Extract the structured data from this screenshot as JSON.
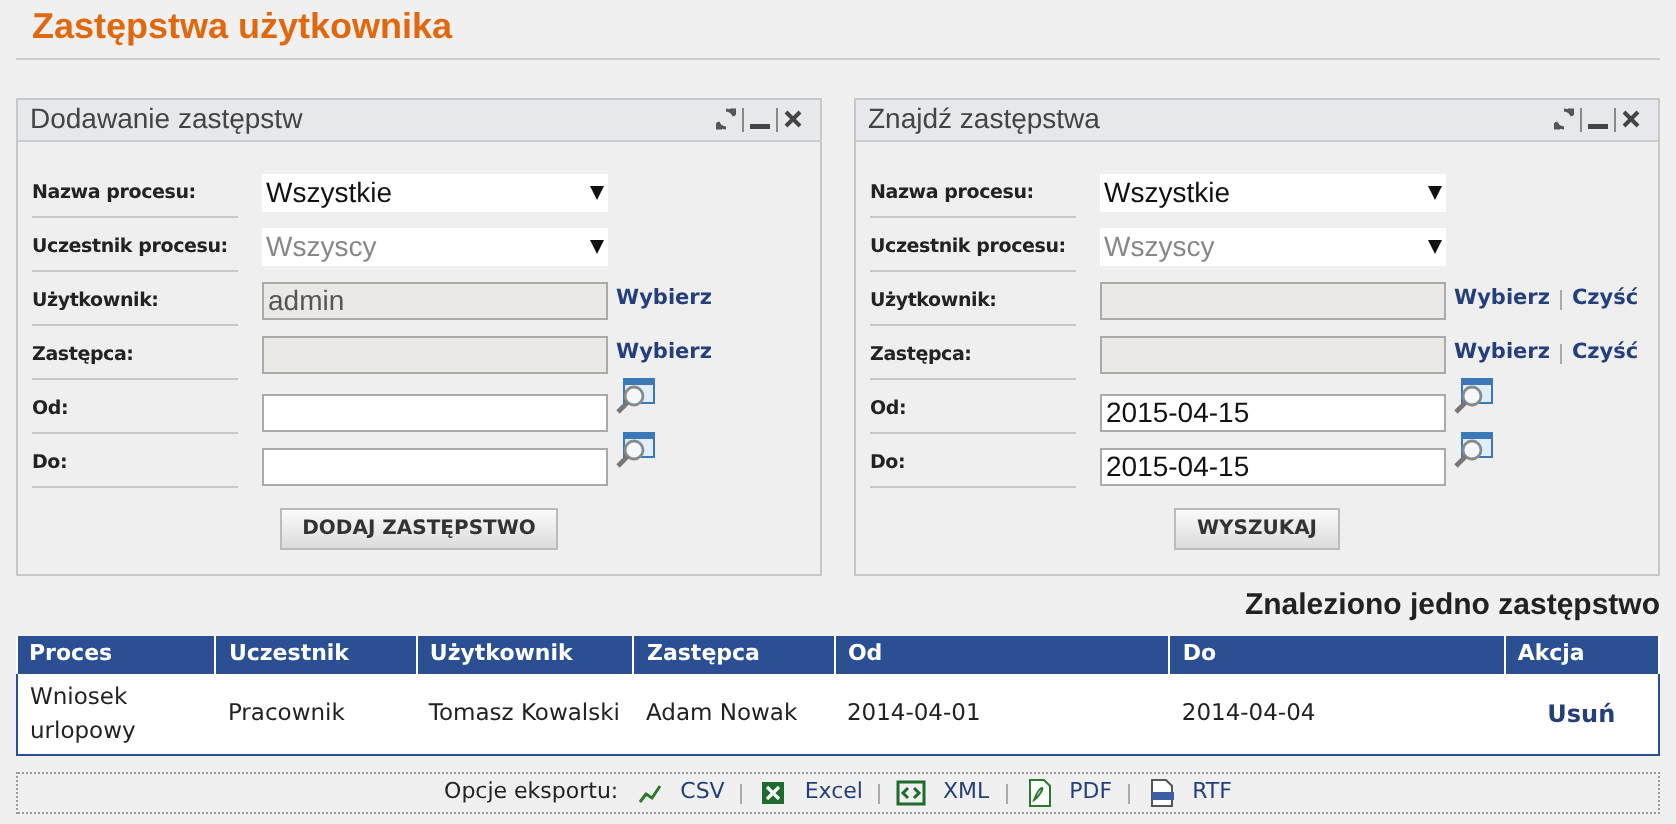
{
  "page_title": "Zastępstwa użytkownika",
  "panels": [
    {
      "title": "Dodawanie zastępstw",
      "fields": [
        {
          "label": "Nazwa procesu:",
          "kind": "select",
          "value": "Wszystkie",
          "disabled": false
        },
        {
          "label": "Uczestnik procesu:",
          "kind": "select",
          "value": "Wszyscy",
          "disabled": true
        },
        {
          "label": "Użytkownik:",
          "kind": "text",
          "value": "admin",
          "disabled": true,
          "links": [
            "Wybierz"
          ]
        },
        {
          "label": "Zastępca:",
          "kind": "text",
          "disabled": true,
          "links": [
            "Wybierz"
          ]
        },
        {
          "label": "Od:",
          "kind": "date",
          "disabled": false
        },
        {
          "label": "Do:",
          "kind": "date",
          "disabled": false
        }
      ],
      "button": "DODAJ ZASTĘPSTWO"
    },
    {
      "title": "Znajdź zastępstwa",
      "fields": [
        {
          "label": "Nazwa procesu:",
          "kind": "select",
          "value": "Wszystkie",
          "disabled": false
        },
        {
          "label": "Uczestnik procesu:",
          "kind": "select",
          "value": "Wszyscy",
          "disabled": true
        },
        {
          "label": "Użytkownik:",
          "kind": "text",
          "disabled": true,
          "links": [
            "Wybierz",
            "Czyść"
          ]
        },
        {
          "label": "Zastępca:",
          "kind": "text",
          "disabled": true,
          "links": [
            "Wybierz",
            "Czyść"
          ]
        },
        {
          "label": "Od:",
          "kind": "date",
          "value": "2015-04-15",
          "disabled": false
        },
        {
          "label": "Do:",
          "kind": "date",
          "value": "2015-04-15",
          "disabled": false
        }
      ],
      "button": "WYSZUKAJ"
    }
  ],
  "result_count": "Znaleziono jedno zastępstwo",
  "table": {
    "columns": [
      "Proces",
      "Uczestnik",
      "Użytkownik",
      "Zastępca",
      "Od",
      "Do",
      "Akcja"
    ],
    "rows": [
      {
        "cells": [
          "Wniosek urlopowy",
          "Pracownik",
          "Tomasz Kowalski",
          "Adam Nowak",
          "2014-04-01",
          "2014-04-04"
        ],
        "action": "Usuń"
      }
    ]
  },
  "export": {
    "label": "Opcje eksportu:",
    "options": [
      {
        "label": "CSV",
        "kind": "csv"
      },
      {
        "label": "Excel",
        "kind": "excel"
      },
      {
        "label": "XML",
        "kind": "xml"
      },
      {
        "label": "PDF",
        "kind": "pdf"
      },
      {
        "label": "RTF",
        "kind": "rtf"
      }
    ]
  }
}
